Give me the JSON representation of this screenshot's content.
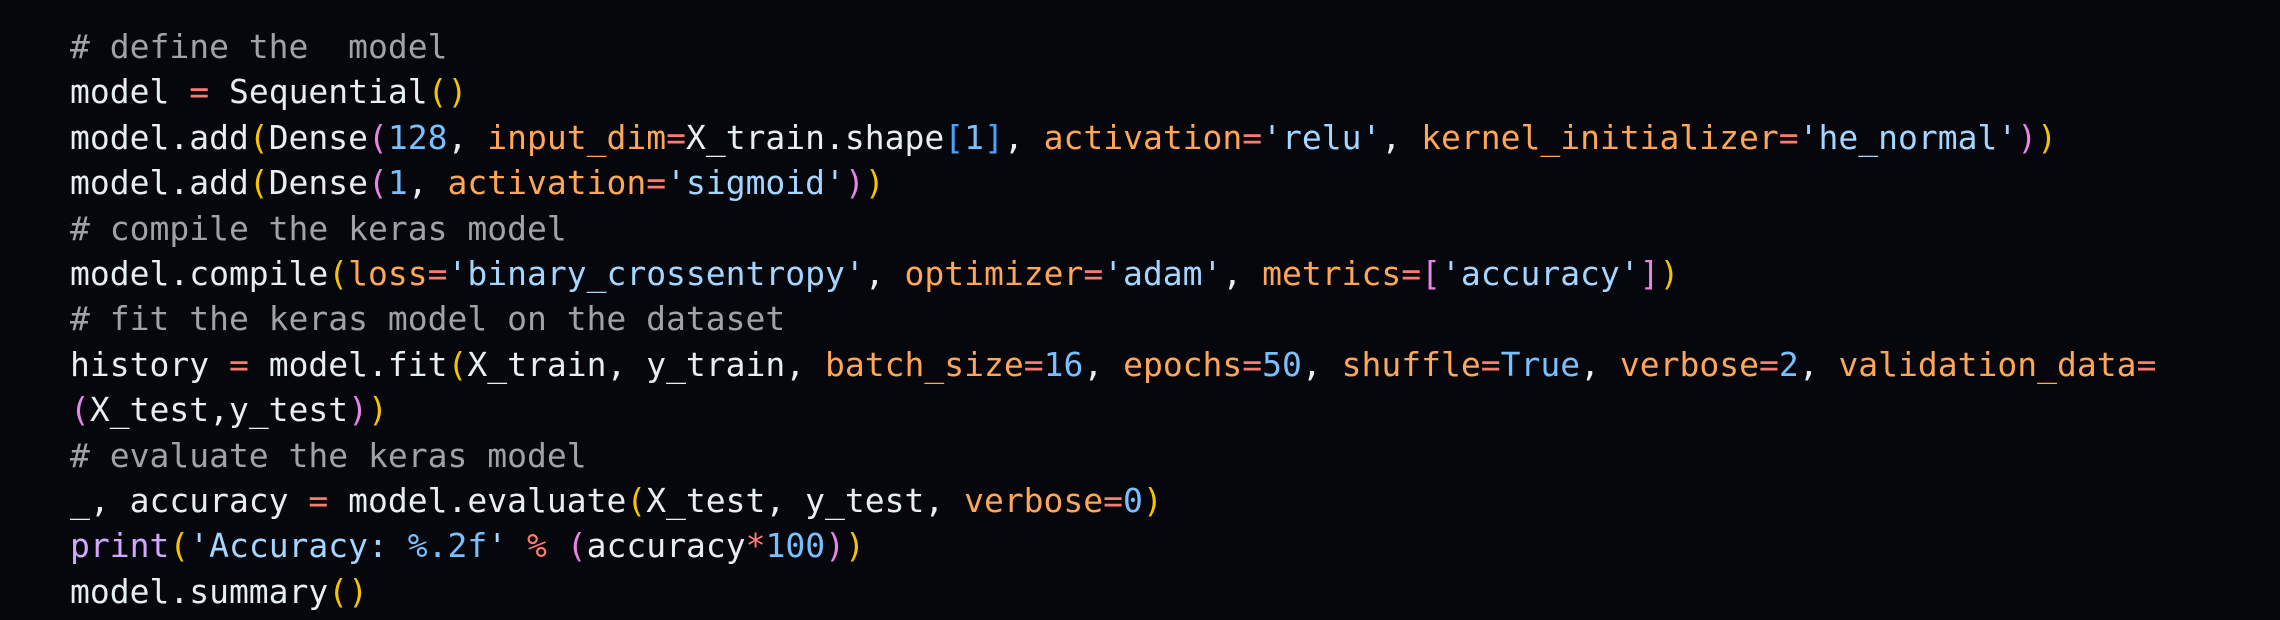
{
  "code_block": {
    "language": "python",
    "lines": [
      [
        {
          "t": "# define the  model",
          "c": "comment"
        }
      ],
      [
        {
          "t": "model ",
          "c": "plain"
        },
        {
          "t": "=",
          "c": "op"
        },
        {
          "t": " Sequential",
          "c": "plain"
        },
        {
          "t": "()",
          "c": "brace1"
        }
      ],
      [
        {
          "t": "model.add",
          "c": "plain"
        },
        {
          "t": "(",
          "c": "brace1"
        },
        {
          "t": "Dense",
          "c": "plain"
        },
        {
          "t": "(",
          "c": "brace2"
        },
        {
          "t": "128",
          "c": "num"
        },
        {
          "t": ", ",
          "c": "plain"
        },
        {
          "t": "input_dim",
          "c": "kw"
        },
        {
          "t": "=",
          "c": "op"
        },
        {
          "t": "X_train.shape",
          "c": "plain"
        },
        {
          "t": "[",
          "c": "brace3"
        },
        {
          "t": "1",
          "c": "num"
        },
        {
          "t": "]",
          "c": "brace3"
        },
        {
          "t": ", ",
          "c": "plain"
        },
        {
          "t": "activation",
          "c": "kw"
        },
        {
          "t": "=",
          "c": "op"
        },
        {
          "t": "'relu'",
          "c": "str"
        },
        {
          "t": ", ",
          "c": "plain"
        },
        {
          "t": "kernel_initializer",
          "c": "kw"
        },
        {
          "t": "=",
          "c": "op"
        },
        {
          "t": "'he_normal'",
          "c": "str"
        },
        {
          "t": ")",
          "c": "brace2"
        },
        {
          "t": ")",
          "c": "brace1"
        }
      ],
      [
        {
          "t": "model.add",
          "c": "plain"
        },
        {
          "t": "(",
          "c": "brace1"
        },
        {
          "t": "Dense",
          "c": "plain"
        },
        {
          "t": "(",
          "c": "brace2"
        },
        {
          "t": "1",
          "c": "num"
        },
        {
          "t": ", ",
          "c": "plain"
        },
        {
          "t": "activation",
          "c": "kw"
        },
        {
          "t": "=",
          "c": "op"
        },
        {
          "t": "'sigmoid'",
          "c": "str"
        },
        {
          "t": ")",
          "c": "brace2"
        },
        {
          "t": ")",
          "c": "brace1"
        }
      ],
      [
        {
          "t": "# compile the keras model",
          "c": "comment"
        }
      ],
      [
        {
          "t": "model.compile",
          "c": "plain"
        },
        {
          "t": "(",
          "c": "brace1"
        },
        {
          "t": "loss",
          "c": "kw"
        },
        {
          "t": "=",
          "c": "op"
        },
        {
          "t": "'binary_crossentropy'",
          "c": "str"
        },
        {
          "t": ", ",
          "c": "plain"
        },
        {
          "t": "optimizer",
          "c": "kw"
        },
        {
          "t": "=",
          "c": "op"
        },
        {
          "t": "'adam'",
          "c": "str"
        },
        {
          "t": ", ",
          "c": "plain"
        },
        {
          "t": "metrics",
          "c": "kw"
        },
        {
          "t": "=",
          "c": "op"
        },
        {
          "t": "[",
          "c": "brace2"
        },
        {
          "t": "'accuracy'",
          "c": "str"
        },
        {
          "t": "]",
          "c": "brace2"
        },
        {
          "t": ")",
          "c": "brace1"
        }
      ],
      [
        {
          "t": "# fit the keras model on the dataset",
          "c": "comment"
        }
      ],
      [
        {
          "t": "history ",
          "c": "plain"
        },
        {
          "t": "=",
          "c": "op"
        },
        {
          "t": " model.fit",
          "c": "plain"
        },
        {
          "t": "(",
          "c": "brace1"
        },
        {
          "t": "X_train, y_train, ",
          "c": "plain"
        },
        {
          "t": "batch_size",
          "c": "kw"
        },
        {
          "t": "=",
          "c": "op"
        },
        {
          "t": "16",
          "c": "num"
        },
        {
          "t": ", ",
          "c": "plain"
        },
        {
          "t": "epochs",
          "c": "kw"
        },
        {
          "t": "=",
          "c": "op"
        },
        {
          "t": "50",
          "c": "num"
        },
        {
          "t": ", ",
          "c": "plain"
        },
        {
          "t": "shuffle",
          "c": "kw"
        },
        {
          "t": "=",
          "c": "op"
        },
        {
          "t": "True",
          "c": "num"
        },
        {
          "t": ", ",
          "c": "plain"
        },
        {
          "t": "verbose",
          "c": "kw"
        },
        {
          "t": "=",
          "c": "op"
        },
        {
          "t": "2",
          "c": "num"
        },
        {
          "t": ", ",
          "c": "plain"
        },
        {
          "t": "validation_data",
          "c": "kw"
        },
        {
          "t": "=",
          "c": "op"
        }
      ],
      [
        {
          "t": "(",
          "c": "brace2"
        },
        {
          "t": "X_test,y_test",
          "c": "plain"
        },
        {
          "t": ")",
          "c": "brace2"
        },
        {
          "t": ")",
          "c": "brace1"
        }
      ],
      [
        {
          "t": "# evaluate the keras model",
          "c": "comment"
        }
      ],
      [
        {
          "t": "_, accuracy ",
          "c": "plain"
        },
        {
          "t": "=",
          "c": "op"
        },
        {
          "t": " model.evaluate",
          "c": "plain"
        },
        {
          "t": "(",
          "c": "brace1"
        },
        {
          "t": "X_test, y_test, ",
          "c": "plain"
        },
        {
          "t": "verbose",
          "c": "kw"
        },
        {
          "t": "=",
          "c": "op"
        },
        {
          "t": "0",
          "c": "num"
        },
        {
          "t": ")",
          "c": "brace1"
        }
      ],
      [
        {
          "t": "print",
          "c": "builtin"
        },
        {
          "t": "(",
          "c": "brace1"
        },
        {
          "t": "'Accuracy: ",
          "c": "str"
        },
        {
          "t": "%.2f",
          "c": "num"
        },
        {
          "t": "'",
          "c": "str"
        },
        {
          "t": " ",
          "c": "plain"
        },
        {
          "t": "%",
          "c": "op"
        },
        {
          "t": " ",
          "c": "plain"
        },
        {
          "t": "(",
          "c": "brace2"
        },
        {
          "t": "accuracy",
          "c": "plain"
        },
        {
          "t": "*",
          "c": "op"
        },
        {
          "t": "100",
          "c": "num"
        },
        {
          "t": ")",
          "c": "brace2"
        },
        {
          "t": ")",
          "c": "brace1"
        }
      ],
      [
        {
          "t": "model.summary",
          "c": "plain"
        },
        {
          "t": "()",
          "c": "brace1"
        }
      ]
    ]
  },
  "colors": {
    "background": "#05070d",
    "comment": "#9ea3a9",
    "plain": "#e6edf3",
    "operator": "#ff7b72",
    "keyword_argument": "#ffa657",
    "string": "#a5d6ff",
    "number": "#79c0ff",
    "builtin": "#d2a8ff",
    "bracket_level_1": "#f5c400",
    "bracket_level_2": "#e884e4",
    "bracket_level_3": "#4aa4ff"
  }
}
